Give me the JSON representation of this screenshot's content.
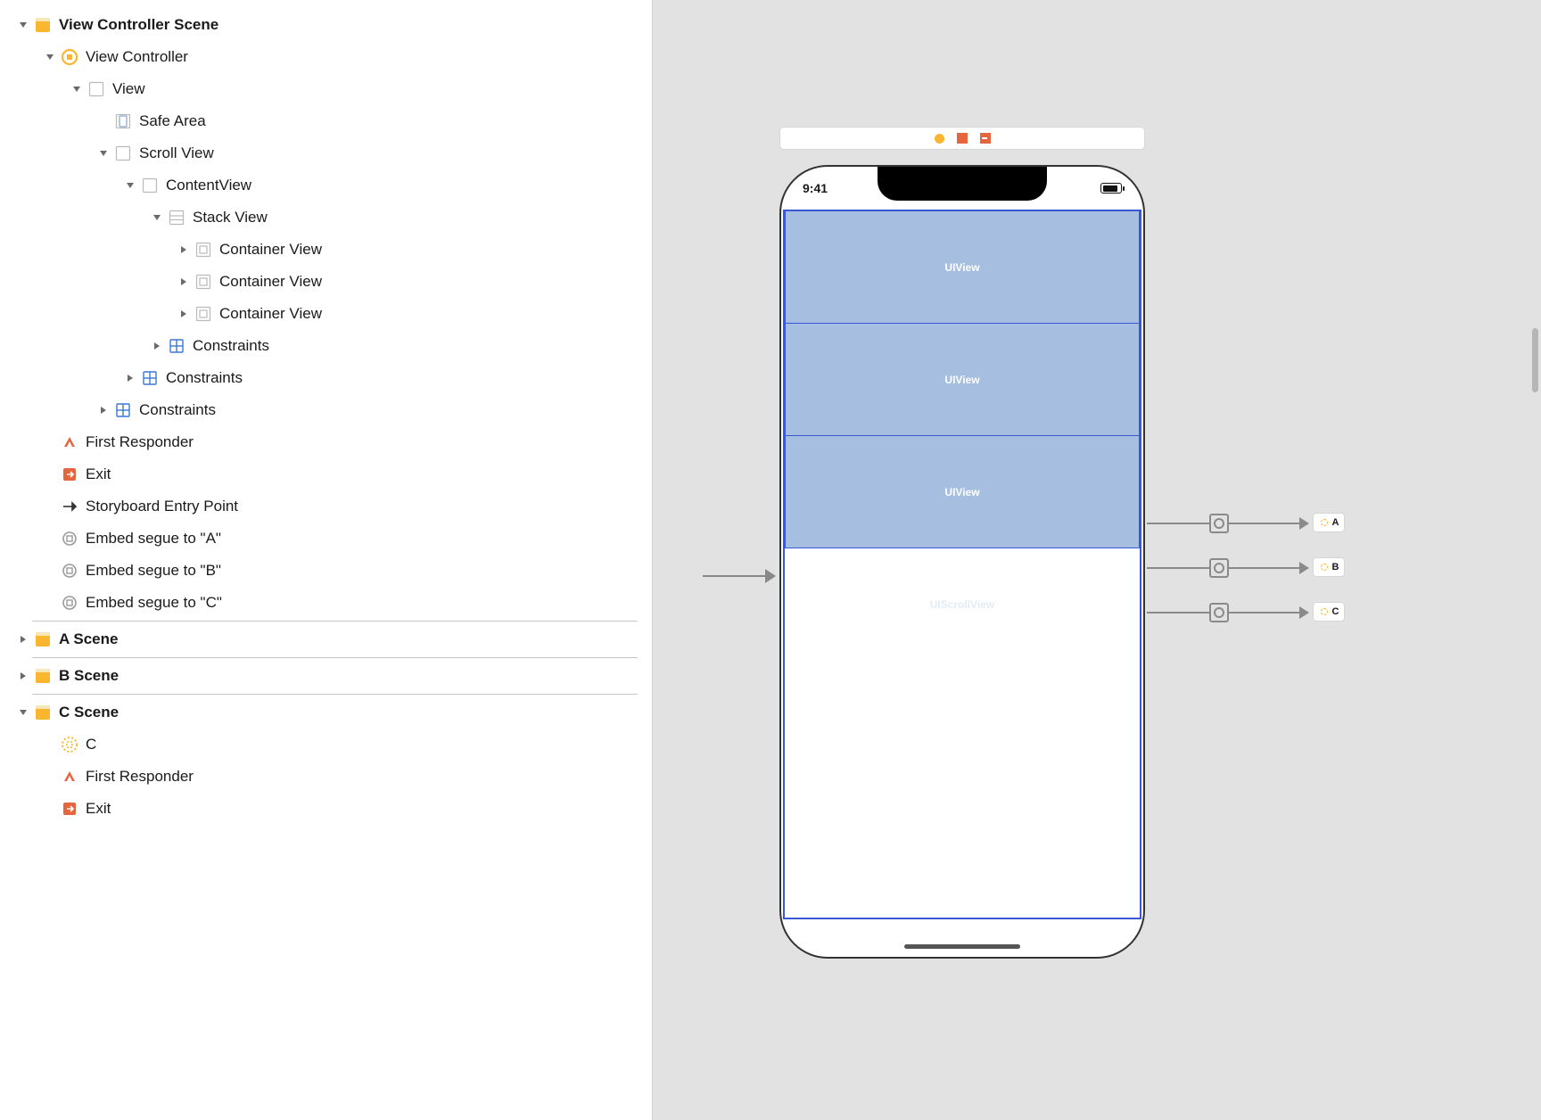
{
  "outline": {
    "scene1": "View Controller Scene",
    "vc": "View Controller",
    "view": "View",
    "safe": "Safe Area",
    "scroll": "Scroll View",
    "content": "ContentView",
    "stack": "Stack View",
    "cv1": "Container View",
    "cv2": "Container View",
    "cv3": "Container View",
    "constraints": "Constraints",
    "fr": "First Responder",
    "exit": "Exit",
    "entry": "Storyboard Entry Point",
    "segueA": "Embed segue to \"A\"",
    "segueB": "Embed segue to \"B\"",
    "segueC": "Embed segue to \"C\"",
    "aScene": "A Scene",
    "bScene": "B Scene",
    "cScene": "C Scene",
    "cVC": "C"
  },
  "canvas": {
    "time": "9:41",
    "uiview_label": "UIView",
    "scroll_label": "UIScrollView",
    "dest": {
      "a": "A",
      "b": "B",
      "c": "C"
    }
  }
}
